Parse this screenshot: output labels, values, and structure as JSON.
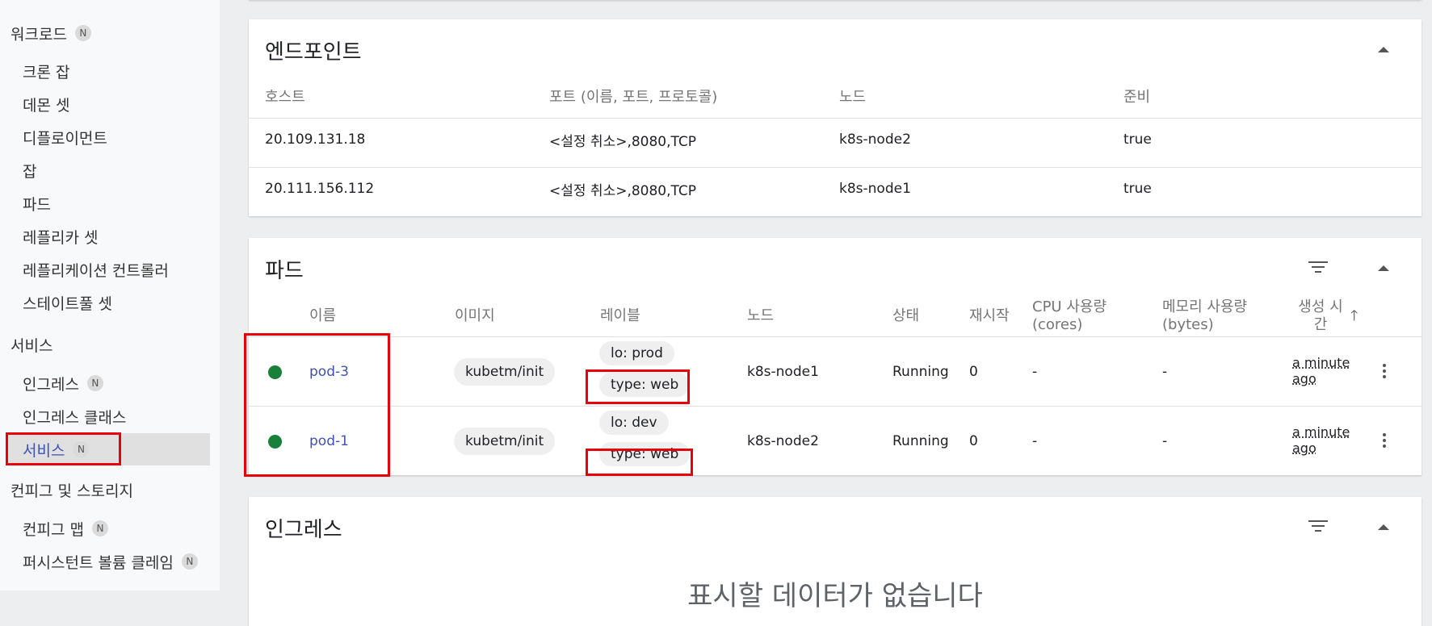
{
  "sidebar": {
    "workloads": {
      "label": "워크로드",
      "badge": "N"
    },
    "workload_items": [
      "크론 잡",
      "데몬 셋",
      "디플로이먼트",
      "잡",
      "파드",
      "레플리카 셋",
      "레플리케이션 컨트롤러",
      "스테이트풀 셋"
    ],
    "services": {
      "label": "서비스"
    },
    "service_items": [
      {
        "label": "인그레스",
        "badge": "N"
      },
      {
        "label": "인그레스 클래스"
      },
      {
        "label": "서비스",
        "badge": "N"
      }
    ],
    "config": {
      "label": "컨피그 및 스토리지"
    },
    "config_items": [
      {
        "label": "컨피그 맵",
        "badge": "N"
      },
      {
        "label": "퍼시스턴트 볼륨 클레임",
        "badge": "N"
      }
    ]
  },
  "endpoints": {
    "title": "엔드포인트",
    "columns": [
      "호스트",
      "포트 (이름, 포트, 프로토콜)",
      "노드",
      "준비"
    ],
    "rows": [
      {
        "host": "20.109.131.18",
        "ports": "<설정 취소>,8080,TCP",
        "node": "k8s-node2",
        "ready": "true"
      },
      {
        "host": "20.111.156.112",
        "ports": "<설정 취소>,8080,TCP",
        "node": "k8s-node1",
        "ready": "true"
      }
    ]
  },
  "pods": {
    "title": "파드",
    "columns": {
      "name": "이름",
      "image": "이미지",
      "labels": "레이블",
      "node": "노드",
      "status": "상태",
      "restarts": "재시작",
      "cpu_1": "CPU 사용량",
      "cpu_2": "(cores)",
      "mem_1": "메모리 사용량",
      "mem_2": "(bytes)",
      "created_1": "생성 시",
      "created_2": "간"
    },
    "rows": [
      {
        "name": "pod-3",
        "image": "kubetm/init",
        "label_1": "lo: prod",
        "label_2": "type: web",
        "node": "k8s-node1",
        "status": "Running",
        "restarts": "0",
        "cpu": "-",
        "memory": "-",
        "age_1": "a minute",
        "age_2": "ago"
      },
      {
        "name": "pod-1",
        "image": "kubetm/init",
        "label_1": "lo: dev",
        "label_2": "type: web",
        "node": "k8s-node2",
        "status": "Running",
        "restarts": "0",
        "cpu": "-",
        "memory": "-",
        "age_1": "a minute",
        "age_2": "ago"
      }
    ]
  },
  "ingress": {
    "title": "인그레스",
    "empty_message": "표시할 데이터가 없습니다"
  },
  "colors": {
    "accent": "#3f51b5",
    "running": "#188038",
    "highlight": "#e8000b"
  },
  "icons": [
    "collapse-icon",
    "filter-icon",
    "kebab-menu-icon",
    "sort-ascending-icon",
    "status-running-icon"
  ]
}
